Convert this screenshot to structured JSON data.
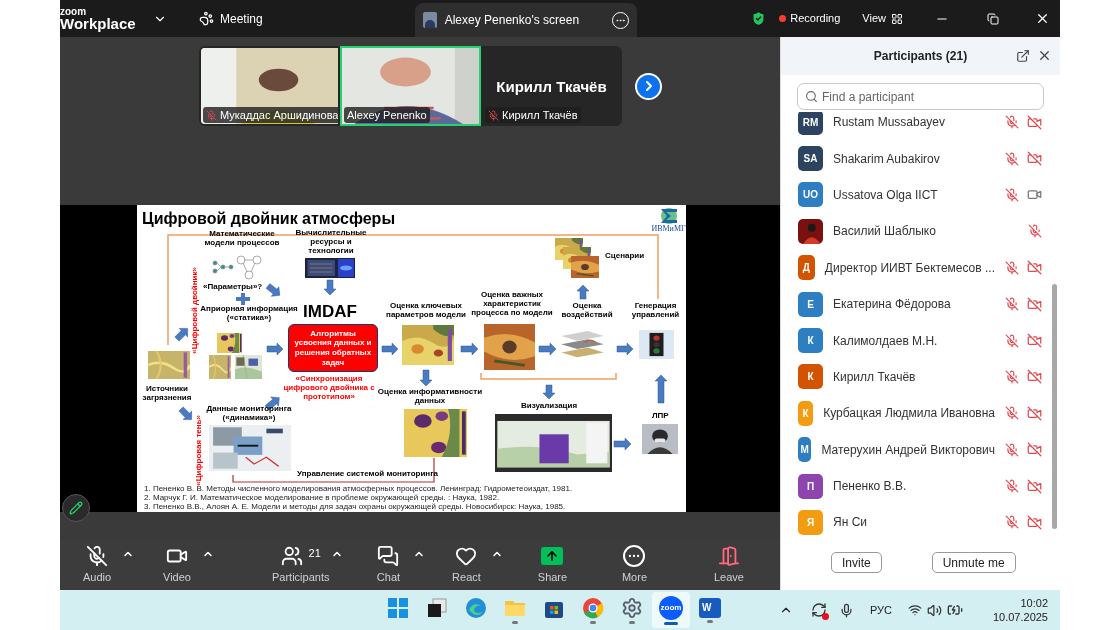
{
  "app": {
    "logo_top": "zoom",
    "logo_bottom": "Workplace",
    "menu_label": "Meeting"
  },
  "share_tab": {
    "label": "Alexey Penenko's screen"
  },
  "top_right": {
    "recording": "Recording",
    "view": "View"
  },
  "video_tiles": [
    {
      "kind": "video",
      "name": "Мукаддас Аршидинова",
      "muted": true,
      "speaking": false
    },
    {
      "kind": "video",
      "name": "Alexey Penenko",
      "muted": false,
      "speaking": true
    },
    {
      "kind": "name",
      "display_name": "Кирилл Ткачёв",
      "name": "Кирилл Ткачёв",
      "muted": true,
      "speaking": false
    }
  ],
  "slide": {
    "title": "Цифровой двойник атмосферы",
    "logo_text": "ИВМиМГ",
    "math_models": "Математические модели процессов",
    "parameters": "«Параметры»?",
    "a_priori": "Априорная информация («статика»)",
    "twin_label": "«Цифровой двойник»",
    "compute": "Вычислительные ресурсы и технологии",
    "imdaf": "IMDAF",
    "algorithms": "Алгоритмы усвоения данных и решения обратных задач",
    "sync": "«Синхронизация цифрового двойника с прототипом»",
    "key_params": "Оценка ключевых параметров модели",
    "important": "Оценка важных характеристик процесса по модели",
    "impact": "Оценка воздействий",
    "scenarios": "Сценарии",
    "control_gen": "Генерация управлений",
    "sources": "Источники загрязнения",
    "monitoring": "Данные мониторинга («динамика»)",
    "shadow_label": "«Цифровая тень»",
    "informativeness": "Оценка информативности данных",
    "monitoring_control": "Управление системой мониторинга",
    "visualization": "Визуализация",
    "dm": "ЛПР",
    "references": [
      "1.   Пененко В. В. Методы численного моделирования атмосферных процессов. Ленинград: Гидрометеоиздат, 1981.",
      "2.   Марчук Г. И. Математическое моделирование в проблеме окружающей среды. : Наука, 1982.",
      "3.   Пененко В.В., Алоян А. Е. Модели и методы для задач охраны окружающей среды. Новосибирск: Наука, 1985."
    ]
  },
  "toolbar": [
    {
      "kind": "audio",
      "label": "Audio",
      "off": true,
      "has_menu": true
    },
    {
      "kind": "video",
      "label": "Video",
      "off": false,
      "has_menu": true
    },
    {
      "kind": "participants",
      "label": "Participants",
      "count": "21",
      "has_menu": true
    },
    {
      "kind": "chat",
      "label": "Chat",
      "has_menu": true
    },
    {
      "kind": "react",
      "label": "React",
      "has_menu": true
    },
    {
      "kind": "share",
      "label": "Share",
      "has_menu": false
    },
    {
      "kind": "more",
      "label": "More",
      "has_menu": false
    },
    {
      "kind": "leave",
      "label": "Leave",
      "has_menu": false
    }
  ],
  "participants_panel": {
    "title": "Participants (21)",
    "search_placeholder": "Find a participant",
    "participants": [
      {
        "kind": "initials",
        "avatar": "RM",
        "color": "#2c4460",
        "name": "Rustam Mussabayev",
        "mic_muted": true,
        "camera_off": true
      },
      {
        "kind": "initials",
        "avatar": "SA",
        "color": "#2c4460",
        "name": "Shakarim Aubakirov",
        "mic_muted": true,
        "camera_off": true
      },
      {
        "kind": "initials",
        "avatar": "UO",
        "color": "#2d7fc1",
        "name": "Ussatova Olga IICT",
        "mic_muted": true,
        "camera_off": false
      },
      {
        "kind": "picture",
        "name": "Василий Шаблыко",
        "mic_muted": true
      },
      {
        "kind": "initials",
        "avatar": "Д",
        "color": "#d35400",
        "name": "Директор ИИВТ Бектемесов ...",
        "mic_muted": true,
        "camera_off": true
      },
      {
        "kind": "initials",
        "avatar": "Е",
        "color": "#2d7fc1",
        "name": "Екатерина Фёдорова",
        "mic_muted": true,
        "camera_off": true
      },
      {
        "kind": "initials",
        "avatar": "К",
        "color": "#2d7fc1",
        "name": "Калимолдаев М.Н.",
        "mic_muted": true,
        "camera_off": true
      },
      {
        "kind": "initials",
        "avatar": "К",
        "color": "#d35400",
        "name": "Кирилл Ткачёв",
        "mic_muted": true,
        "camera_off": true
      },
      {
        "kind": "initials",
        "avatar": "К",
        "color": "#f39c12",
        "name": "Курбацкая Людмила Ивановна",
        "mic_muted": true,
        "camera_off": true
      },
      {
        "kind": "initials",
        "avatar": "М",
        "color": "#2d7fc1",
        "name": "Матерухин Андрей Викторович",
        "mic_muted": true,
        "camera_off": true
      },
      {
        "kind": "initials",
        "avatar": "П",
        "color": "#8e44ad",
        "name": "Пененко В.В.",
        "mic_muted": true,
        "camera_off": true
      },
      {
        "kind": "initials",
        "avatar": "Я",
        "color": "#f39c12",
        "name": "Ян Си",
        "mic_muted": true,
        "camera_off": true
      }
    ],
    "buttons": [
      "Invite",
      "Unmute me"
    ]
  },
  "taskbar": {
    "apps": [
      {
        "kind": "start",
        "running": false,
        "selected": false
      },
      {
        "kind": "taskview",
        "running": false,
        "selected": false
      },
      {
        "kind": "edge",
        "running": false,
        "selected": false
      },
      {
        "kind": "explorer",
        "running": true,
        "selected": false
      },
      {
        "kind": "store",
        "running": false,
        "selected": false
      },
      {
        "kind": "chrome",
        "running": true,
        "selected": false
      },
      {
        "kind": "settings",
        "running": true,
        "selected": false
      },
      {
        "kind": "zoom",
        "label": "zoom",
        "running": true,
        "selected": true
      },
      {
        "kind": "word",
        "label": "W",
        "running": true,
        "selected": false
      }
    ],
    "language": "РУС",
    "time": "10:02",
    "date": "10.07.2025"
  }
}
